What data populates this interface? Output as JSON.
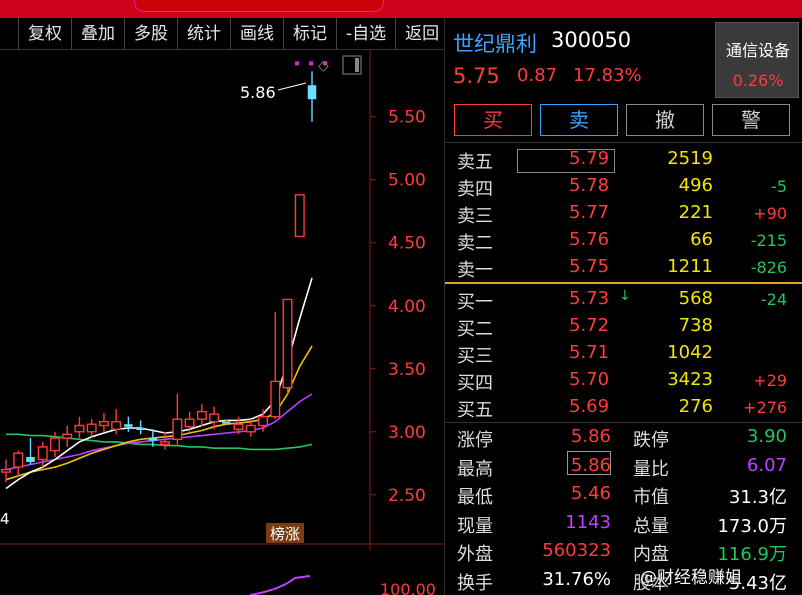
{
  "toolbar": {
    "items": [
      "复权",
      "叠加",
      "多股",
      "统计",
      "画线",
      "标记",
      "-自选",
      "返回"
    ]
  },
  "chart": {
    "y_ticks": [
      "5.50",
      "5.00",
      "4.50",
      "4.00",
      "3.50",
      "3.00",
      "2.50"
    ],
    "high_annotation": "5.86",
    "left_fragment": "4",
    "bottom_tick": "100.00",
    "badge": "榜涨",
    "colors": {
      "up": "#ff3b3b",
      "limit": "#66e0ff",
      "ma_white": "#ffffff",
      "ma_yellow": "#f2c200",
      "ma_purple": "#c040ff",
      "ma_green": "#22c55e",
      "grid": "#8b1a1a"
    }
  },
  "chart_data": {
    "type": "candlestick",
    "ylim": [
      2.3,
      5.95
    ],
    "candles": [
      {
        "o": 2.68,
        "h": 2.78,
        "l": 2.6,
        "c": 2.7
      },
      {
        "o": 2.72,
        "h": 2.85,
        "l": 2.65,
        "c": 2.83
      },
      {
        "o": 2.8,
        "h": 2.95,
        "l": 2.74,
        "c": 2.76
      },
      {
        "o": 2.78,
        "h": 2.92,
        "l": 2.72,
        "c": 2.88
      },
      {
        "o": 2.85,
        "h": 3.0,
        "l": 2.8,
        "c": 2.95
      },
      {
        "o": 2.95,
        "h": 3.05,
        "l": 2.88,
        "c": 2.98
      },
      {
        "o": 3.0,
        "h": 3.12,
        "l": 2.95,
        "c": 3.05
      },
      {
        "o": 3.0,
        "h": 3.1,
        "l": 2.96,
        "c": 3.06
      },
      {
        "o": 3.05,
        "h": 3.15,
        "l": 3.0,
        "c": 3.08
      },
      {
        "o": 3.02,
        "h": 3.18,
        "l": 2.98,
        "c": 3.08
      },
      {
        "o": 3.06,
        "h": 3.12,
        "l": 3.0,
        "c": 3.04
      },
      {
        "o": 3.03,
        "h": 3.09,
        "l": 2.98,
        "c": 3.02
      },
      {
        "o": 2.95,
        "h": 3.02,
        "l": 2.88,
        "c": 2.93
      },
      {
        "o": 2.9,
        "h": 3.0,
        "l": 2.86,
        "c": 2.92
      },
      {
        "o": 2.94,
        "h": 3.3,
        "l": 2.9,
        "c": 3.1
      },
      {
        "o": 3.04,
        "h": 3.16,
        "l": 3.0,
        "c": 3.1
      },
      {
        "o": 3.1,
        "h": 3.22,
        "l": 3.04,
        "c": 3.16
      },
      {
        "o": 3.08,
        "h": 3.2,
        "l": 3.02,
        "c": 3.14
      },
      {
        "o": 3.08,
        "h": 3.1,
        "l": 3.06,
        "c": 3.08
      },
      {
        "o": 3.02,
        "h": 3.12,
        "l": 2.98,
        "c": 3.06
      },
      {
        "o": 3.0,
        "h": 3.1,
        "l": 2.96,
        "c": 3.05
      },
      {
        "o": 3.05,
        "h": 3.18,
        "l": 3.0,
        "c": 3.12
      },
      {
        "o": 3.12,
        "h": 3.95,
        "l": 3.1,
        "c": 3.4
      },
      {
        "o": 3.35,
        "h": 4.05,
        "l": 3.3,
        "c": 4.05
      },
      {
        "o": 4.55,
        "h": 4.88,
        "l": 4.55,
        "c": 4.88
      },
      {
        "o": 5.46,
        "h": 5.86,
        "l": 5.46,
        "c": 5.75
      }
    ],
    "ma_white": [
      2.55,
      2.62,
      2.68,
      2.72,
      2.78,
      2.85,
      2.92,
      2.96,
      2.99,
      3.02,
      3.03,
      3.03,
      3.01,
      2.99,
      3.0,
      3.02,
      3.05,
      3.08,
      3.09,
      3.09,
      3.1,
      3.14,
      3.25,
      3.55,
      3.9,
      4.22
    ],
    "ma_yellow": [
      2.62,
      2.65,
      2.68,
      2.7,
      2.72,
      2.75,
      2.79,
      2.83,
      2.86,
      2.89,
      2.92,
      2.94,
      2.95,
      2.96,
      2.97,
      2.99,
      3.01,
      3.04,
      3.06,
      3.07,
      3.08,
      3.1,
      3.15,
      3.3,
      3.52,
      3.68
    ],
    "ma_purple": [
      2.7,
      2.72,
      2.74,
      2.76,
      2.78,
      2.8,
      2.82,
      2.85,
      2.87,
      2.89,
      2.91,
      2.92,
      2.93,
      2.94,
      2.95,
      2.96,
      2.97,
      2.98,
      2.99,
      3.0,
      3.01,
      3.03,
      3.08,
      3.16,
      3.24,
      3.3
    ],
    "ma_green": [
      2.98,
      2.98,
      2.97,
      2.97,
      2.96,
      2.95,
      2.94,
      2.93,
      2.92,
      2.92,
      2.91,
      2.9,
      2.9,
      2.89,
      2.89,
      2.88,
      2.88,
      2.87,
      2.87,
      2.87,
      2.86,
      2.86,
      2.86,
      2.87,
      2.88,
      2.9
    ]
  },
  "quote": {
    "name": "世纪鼎利",
    "code": "300050",
    "price": "5.75",
    "change": "0.87",
    "change_pct": "17.83%",
    "sector_name": "通信设备",
    "sector_pct": "0.26%"
  },
  "buttons": {
    "buy": "买",
    "sell": "卖",
    "cancel": "撤",
    "alert": "警"
  },
  "asks": [
    {
      "label": "卖五",
      "price": "5.79",
      "vol": "2519",
      "chg": "",
      "dir": ""
    },
    {
      "label": "卖四",
      "price": "5.78",
      "vol": "496",
      "chg": "-5",
      "dir": "neg"
    },
    {
      "label": "卖三",
      "price": "5.77",
      "vol": "221",
      "chg": "+90",
      "dir": "pos"
    },
    {
      "label": "卖二",
      "price": "5.76",
      "vol": "66",
      "chg": "-215",
      "dir": "neg"
    },
    {
      "label": "卖一",
      "price": "5.75",
      "vol": "1211",
      "chg": "-826",
      "dir": "neg"
    }
  ],
  "bids": [
    {
      "label": "买一",
      "price": "5.73",
      "vol": "568",
      "chg": "-24",
      "dir": "neg"
    },
    {
      "label": "买二",
      "price": "5.72",
      "vol": "738",
      "chg": "",
      "dir": ""
    },
    {
      "label": "买三",
      "price": "5.71",
      "vol": "1042",
      "chg": "",
      "dir": ""
    },
    {
      "label": "买四",
      "price": "5.70",
      "vol": "3423",
      "chg": "+29",
      "dir": "pos"
    },
    {
      "label": "买五",
      "price": "5.69",
      "vol": "276",
      "chg": "+276",
      "dir": "pos"
    }
  ],
  "bid_arrow": "↓",
  "stats": [
    {
      "l1": "涨停",
      "v1": "5.86",
      "c1": "red",
      "l2": "跌停",
      "v2": "3.90",
      "c2": "green"
    },
    {
      "l1": "最高",
      "v1": "5.86",
      "c1": "red",
      "l2": "量比",
      "v2": "6.07",
      "c2": "magenta"
    },
    {
      "l1": "最低",
      "v1": "5.46",
      "c1": "red",
      "l2": "市值",
      "v2": "31.3亿",
      "c2": "white"
    },
    {
      "l1": "现量",
      "v1": "1143",
      "c1": "magenta",
      "l2": "总量",
      "v2": "173.0万",
      "c2": "white"
    },
    {
      "l1": "外盘",
      "v1": "560323",
      "c1": "red",
      "l2": "内盘",
      "v2": "116.9万",
      "c2": "green"
    },
    {
      "l1": "换手",
      "v1": "31.76%",
      "c1": "white",
      "l2": "股本",
      "v2": "5.43亿",
      "c2": "white"
    }
  ],
  "watermark": "@财经稳赚姐"
}
